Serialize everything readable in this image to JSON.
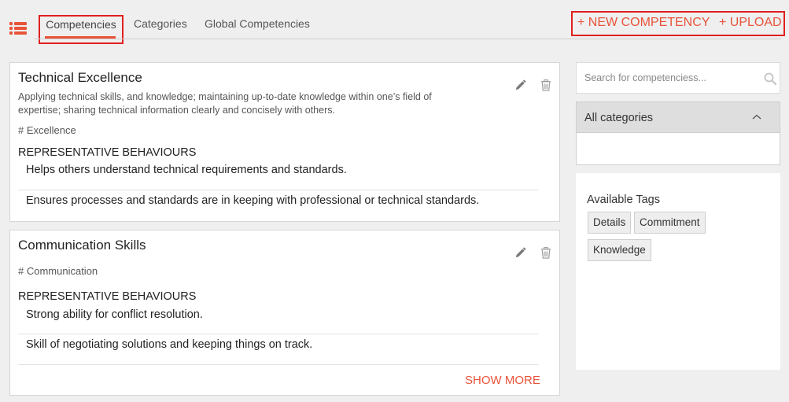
{
  "header": {
    "tabs": [
      {
        "label": "Competencies",
        "active": true
      },
      {
        "label": "Categories",
        "active": false
      },
      {
        "label": "Global Competencies",
        "active": false
      }
    ],
    "new_competency_label": "+ NEW COMPETENCY",
    "upload_label": "+ UPLOAD"
  },
  "competencies": [
    {
      "title": "Technical Excellence",
      "description": "Applying technical skills, and knowledge; maintaining up-to-date knowledge within one’s field of expertise; sharing technical information clearly and concisely with others.",
      "tag": "# Excellence",
      "behaviours_heading": "REPRESENTATIVE BEHAVIOURS",
      "behaviours": [
        "Helps others understand technical requirements and standards.",
        "Ensures processes and standards are in keeping with professional or technical standards."
      ]
    },
    {
      "title": "Communication Skills",
      "description": "",
      "tag": "# Communication",
      "behaviours_heading": "REPRESENTATIVE BEHAVIOURS",
      "behaviours": [
        "Strong ability for conflict resolution.",
        "Skill of negotiating solutions and keeping things on track."
      ],
      "show_more_label": "SHOW MORE"
    }
  ],
  "sidebar": {
    "search": {
      "placeholder": "Search for competenciess...",
      "value": ""
    },
    "category_filter": {
      "selected": "All categories"
    },
    "tags": {
      "title": "Available Tags",
      "items": [
        "Details",
        "Commitment",
        "Knowledge"
      ]
    }
  },
  "icons": {
    "menu": "list-icon",
    "edit": "pencil-icon",
    "delete": "trash-icon",
    "search": "search-icon",
    "chevron": "chevron-up-icon"
  },
  "colors": {
    "accent": "#e8533a",
    "highlight_border": "#e02020",
    "background": "#efefef"
  }
}
